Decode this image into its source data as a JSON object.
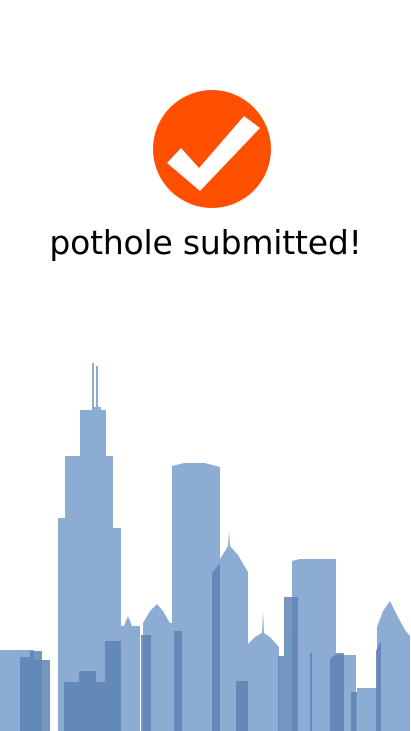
{
  "confirmation": {
    "message": "pothole submitted!",
    "icon": "checkmark-icon",
    "icon_color": "#FF4F00",
    "check_color": "#FFFFFF"
  },
  "illustration": {
    "icon": "city-skyline-illustration",
    "color_light": "#86A8D2",
    "color_dark": "#5E84B5"
  }
}
